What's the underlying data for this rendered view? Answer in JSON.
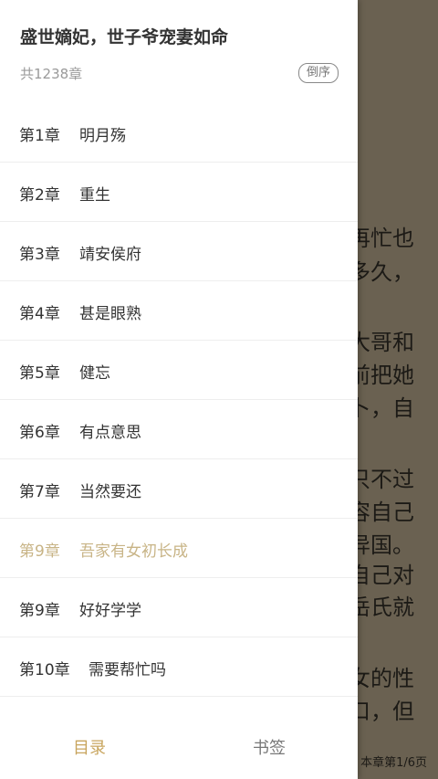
{
  "book": {
    "title": "盛世嫡妃，世子爷宠妻如命",
    "chapter_count": "共1238章",
    "sort_label": "倒序"
  },
  "chapters": [
    {
      "num": "第1章",
      "name": "明月殇",
      "current": false
    },
    {
      "num": "第2章",
      "name": "重生",
      "current": false
    },
    {
      "num": "第3章",
      "name": "靖安侯府",
      "current": false
    },
    {
      "num": "第4章",
      "name": "甚是眼熟",
      "current": false
    },
    {
      "num": "第5章",
      "name": "健忘",
      "current": false
    },
    {
      "num": "第6章",
      "name": "有点意思",
      "current": false
    },
    {
      "num": "第7章",
      "name": "当然要还",
      "current": false
    },
    {
      "num": "第9章",
      "name": "吾家有女初长成",
      "current": true
    },
    {
      "num": "第9章",
      "name": "好好学学",
      "current": false
    },
    {
      "num": "第10章",
      "name": "需要帮忙吗",
      "current": false
    }
  ],
  "tabs": {
    "catalog": "目录",
    "bookmark": "书签"
  },
  "reader": {
    "lines": [
      "再忙也",
      "多久，",
      "大哥和",
      "前把她",
      "卜，自",
      "只不过",
      "容自己",
      "异国。",
      "自己对",
      "岳氏就",
      "女的性",
      "口，但"
    ],
    "page_info": "本章第1/6页"
  },
  "colors": {
    "accent": "#c8a55e",
    "current_chapter": "#c8b486",
    "overlay": "#6a6151"
  }
}
